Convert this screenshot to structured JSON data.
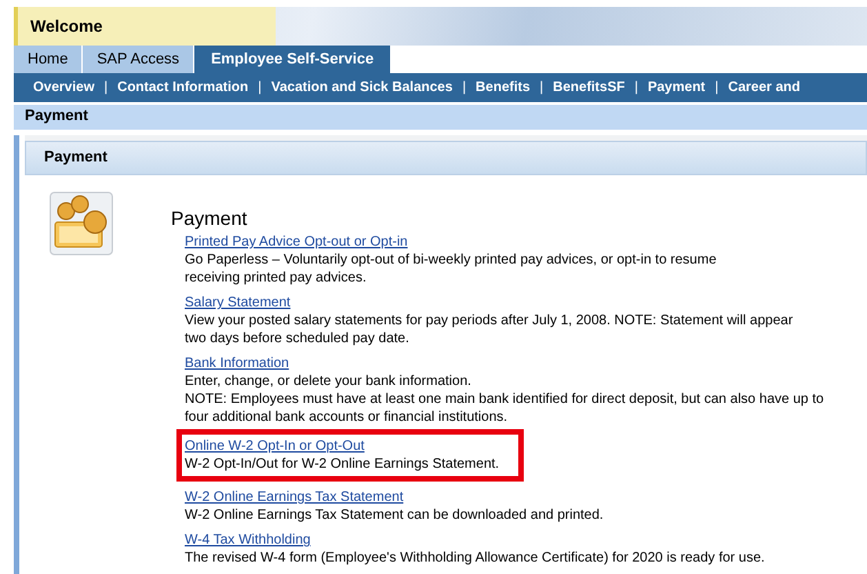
{
  "header": {
    "title": "Welcome"
  },
  "tabs": [
    {
      "label": "Home",
      "selected": false
    },
    {
      "label": "SAP Access",
      "selected": false
    },
    {
      "label": "Employee Self-Service",
      "selected": true
    }
  ],
  "subnav": [
    {
      "kind": "link",
      "label": "Overview"
    },
    {
      "kind": "separator",
      "label": "|"
    },
    {
      "kind": "link",
      "label": "Contact Information"
    },
    {
      "kind": "separator",
      "label": "|"
    },
    {
      "kind": "link",
      "label": "Vacation and Sick Balances"
    },
    {
      "kind": "separator",
      "label": "|"
    },
    {
      "kind": "link",
      "label": "Benefits"
    },
    {
      "kind": "separator",
      "label": "|"
    },
    {
      "kind": "link",
      "label": "BenefitsSF"
    },
    {
      "kind": "separator",
      "label": "|"
    },
    {
      "kind": "link",
      "label": "Payment"
    },
    {
      "kind": "separator",
      "label": "|"
    },
    {
      "kind": "link",
      "label": "Career and"
    }
  ],
  "breadcrumb": "Payment",
  "panel": {
    "title": "Payment",
    "heading": "Payment",
    "items": [
      {
        "link": "Printed Pay Advice Opt-out or Opt-in",
        "lines": [
          "Go Paperless – Voluntarily opt-out of bi-weekly printed pay advices, or opt-in to resume",
          "receiving printed pay advices."
        ],
        "highlighted": false
      },
      {
        "link": "Salary Statement",
        "lines": [
          "View your posted salary statements for pay periods after July 1, 2008.  NOTE: Statement will appear",
          "two days before scheduled pay date."
        ],
        "highlighted": false
      },
      {
        "link": "Bank Information",
        "lines": [
          "Enter, change, or delete your bank information.",
          "NOTE: Employees must have at least one main bank identified for direct deposit, but can also have up to",
          "four additional bank accounts or financial institutions."
        ],
        "highlighted": false
      },
      {
        "link": "Online W-2 Opt-In or Opt-Out",
        "lines": [
          "W-2 Opt-In/Out for W-2 Online Earnings Statement."
        ],
        "highlighted": true
      },
      {
        "link": "W-2 Online Earnings Tax Statement",
        "lines": [
          "W-2 Online Earnings Tax Statement can be downloaded and printed."
        ],
        "highlighted": false
      },
      {
        "link": "W-4 Tax Withholding",
        "lines": [
          "The revised W-4 form (Employee's Withholding Allowance Certificate) for 2020 is ready for use."
        ],
        "highlighted": false
      }
    ]
  }
}
